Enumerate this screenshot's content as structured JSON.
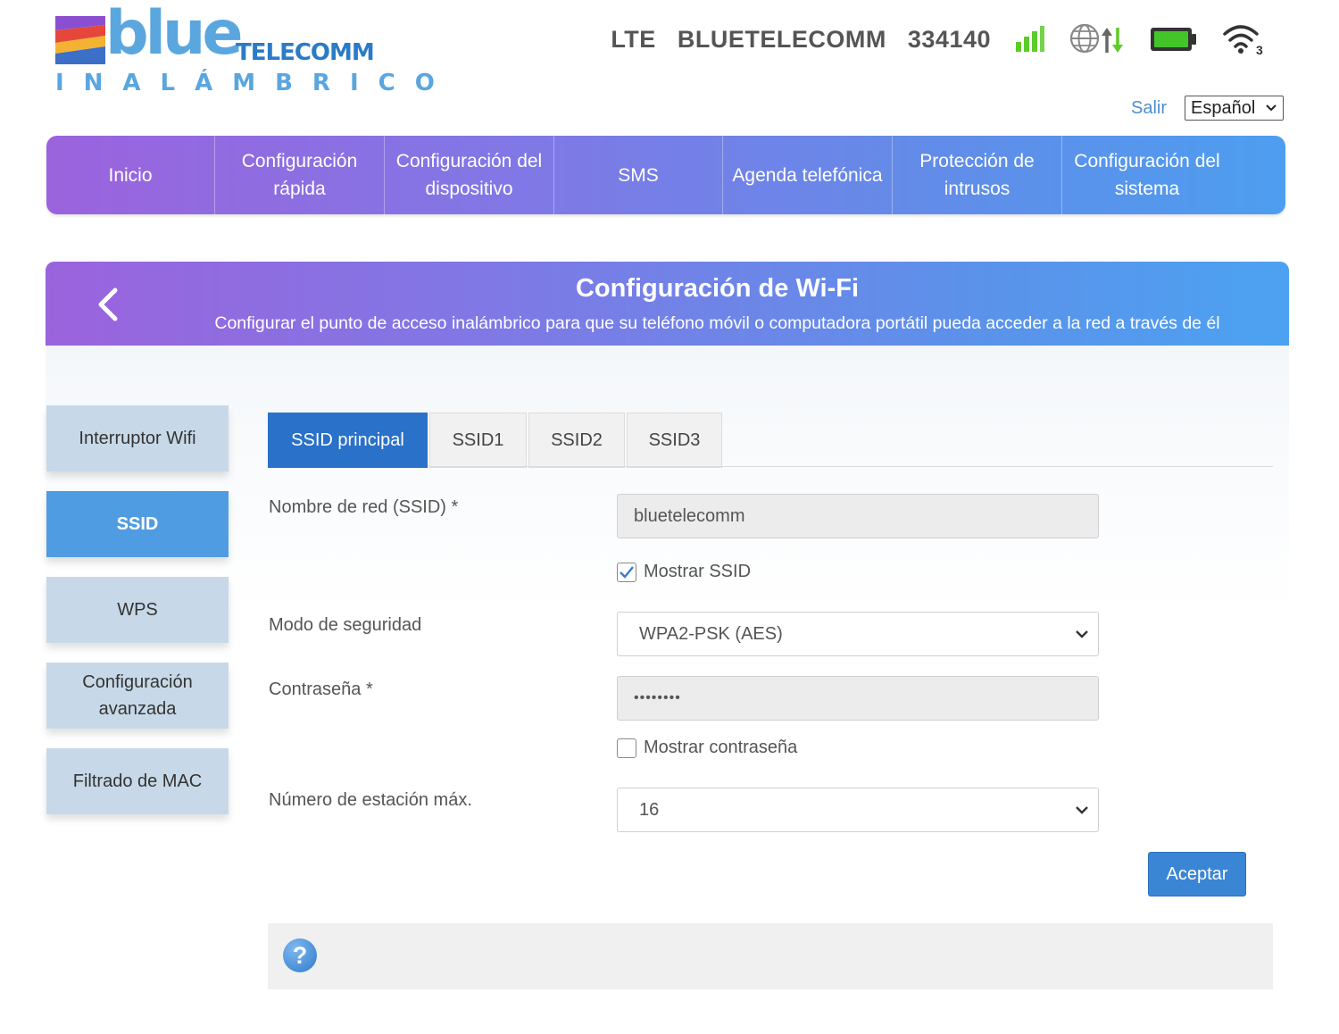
{
  "brand": {
    "word": "blue",
    "telecomm": "TELECOMM",
    "tagline": "INALÁMBRICO"
  },
  "status": {
    "network_type": "LTE",
    "operator": "BLUETELECOMM",
    "code": "334140",
    "signal_icon": "signal-bars-icon",
    "internet_icon": "globe-data-icon",
    "battery_icon": "battery-icon",
    "wifi_icon": "wifi-icon",
    "wifi_clients": "3",
    "signal_color": "#5ccc2a",
    "battery_color": "#43c52a"
  },
  "top_links": {
    "logout": "Salir",
    "language": "Español"
  },
  "nav": [
    {
      "label": "Inicio"
    },
    {
      "label": "Configuración rápida"
    },
    {
      "label": "Configuración del dispositivo"
    },
    {
      "label": "SMS"
    },
    {
      "label": "Agenda telefónica"
    },
    {
      "label": "Protección de intrusos"
    },
    {
      "label": "Configuración del sistema"
    }
  ],
  "page": {
    "title": "Configuración de Wi-Fi",
    "subtitle": "Configurar el punto de acceso inalámbrico para que su teléfono móvil o computadora portátil pueda acceder a la red a través de él"
  },
  "side_menu": [
    {
      "label": "Interruptor Wifi",
      "active": false
    },
    {
      "label": "SSID",
      "active": true
    },
    {
      "label": "WPS",
      "active": false
    },
    {
      "label": "Configuración avanzada",
      "active": false
    },
    {
      "label": "Filtrado de MAC",
      "active": false
    }
  ],
  "tabs": [
    {
      "label": "SSID principal",
      "active": true
    },
    {
      "label": "SSID1",
      "active": false
    },
    {
      "label": "SSID2",
      "active": false
    },
    {
      "label": "SSID3",
      "active": false
    }
  ],
  "form": {
    "ssid_label": "Nombre de red (SSID) *",
    "ssid_value": "bluetelecomm",
    "show_ssid_label": "Mostrar SSID",
    "show_ssid_checked": true,
    "security_label": "Modo de seguridad",
    "security_value": "WPA2-PSK (AES)",
    "password_label": "Contraseña *",
    "password_value": "••••••••",
    "show_password_label": "Mostrar contraseña",
    "show_password_checked": false,
    "max_station_label": "Número de estación máx.",
    "max_station_value": "16",
    "accept_label": "Aceptar"
  },
  "help": {
    "icon_glyph": "?"
  }
}
